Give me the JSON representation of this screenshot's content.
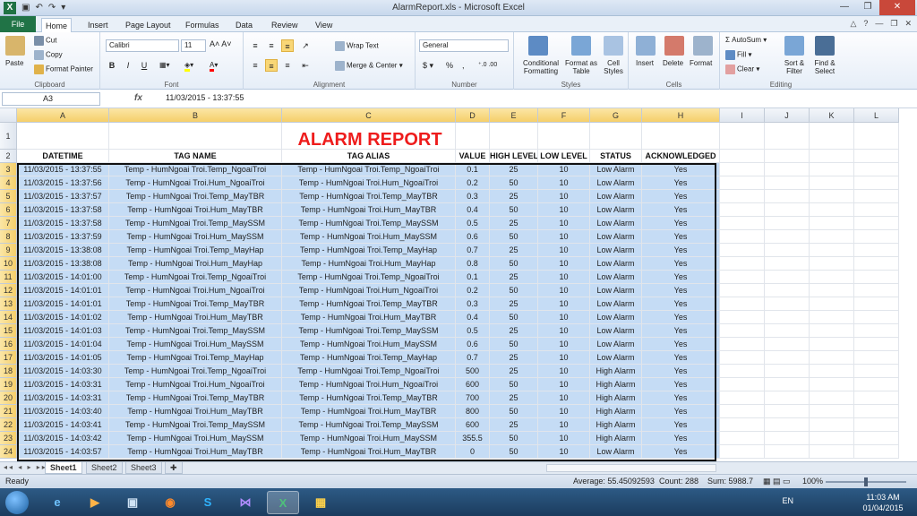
{
  "window": {
    "title": "AlarmReport.xls - Microsoft Excel",
    "app_logo": "X"
  },
  "ribbon_tabs": [
    "File",
    "Home",
    "Insert",
    "Page Layout",
    "Formulas",
    "Data",
    "Review",
    "View"
  ],
  "ribbon": {
    "clipboard": {
      "paste": "Paste",
      "cut": "Cut",
      "copy": "Copy",
      "format_painter": "Format Painter",
      "label": "Clipboard"
    },
    "font": {
      "name": "Calibri",
      "size": "11",
      "bold": "B",
      "italic": "I",
      "underline": "U",
      "label": "Font"
    },
    "alignment": {
      "wrap_text": "Wrap Text",
      "merge_center": "Merge & Center",
      "label": "Alignment"
    },
    "number": {
      "format": "General",
      "currency": "$",
      "percent": "%",
      "comma": ",",
      "label": "Number"
    },
    "styles": {
      "conditional": "Conditional Formatting",
      "format_table": "Format as Table",
      "cell_styles": "Cell Styles",
      "label": "Styles"
    },
    "cells": {
      "insert": "Insert",
      "delete": "Delete",
      "format": "Format",
      "label": "Cells"
    },
    "editing": {
      "autosum": "AutoSum",
      "fill": "Fill",
      "clear": "Clear",
      "sort_filter": "Sort & Filter",
      "find_select": "Find & Select",
      "label": "Editing"
    }
  },
  "formula_bar": {
    "name_box": "A3",
    "fx": "fx",
    "formula": "11/03/2015 - 13:37:55"
  },
  "columns": [
    "A",
    "B",
    "C",
    "D",
    "E",
    "F",
    "G",
    "H",
    "I",
    "J",
    "K",
    "L"
  ],
  "report_title": "ALARM REPORT",
  "headers": [
    "DATETIME",
    "TAG NAME",
    "TAG ALIAS",
    "VALUE",
    "HIGH LEVEL",
    "LOW LEVEL",
    "STATUS",
    "ACKNOWLEDGED"
  ],
  "rows": [
    [
      "11/03/2015 - 13:37:55",
      "Temp - HumNgoai Troi.Temp_NgoaiTroi",
      "Temp - HumNgoai Troi.Temp_NgoaiTroi",
      "0.1",
      "25",
      "10",
      "Low Alarm",
      "Yes"
    ],
    [
      "11/03/2015 - 13:37:56",
      "Temp - HumNgoai Troi.Hum_NgoaiTroi",
      "Temp - HumNgoai Troi.Hum_NgoaiTroi",
      "0.2",
      "50",
      "10",
      "Low Alarm",
      "Yes"
    ],
    [
      "11/03/2015 - 13:37:57",
      "Temp - HumNgoai Troi.Temp_MayTBR",
      "Temp - HumNgoai Troi.Temp_MayTBR",
      "0.3",
      "25",
      "10",
      "Low Alarm",
      "Yes"
    ],
    [
      "11/03/2015 - 13:37:58",
      "Temp - HumNgoai Troi.Hum_MayTBR",
      "Temp - HumNgoai Troi.Hum_MayTBR",
      "0.4",
      "50",
      "10",
      "Low Alarm",
      "Yes"
    ],
    [
      "11/03/2015 - 13:37:58",
      "Temp - HumNgoai Troi.Temp_MaySSM",
      "Temp - HumNgoai Troi.Temp_MaySSM",
      "0.5",
      "25",
      "10",
      "Low Alarm",
      "Yes"
    ],
    [
      "11/03/2015 - 13:37:59",
      "Temp - HumNgoai Troi.Hum_MaySSM",
      "Temp - HumNgoai Troi.Hum_MaySSM",
      "0.6",
      "50",
      "10",
      "Low Alarm",
      "Yes"
    ],
    [
      "11/03/2015 - 13:38:08",
      "Temp - HumNgoai Troi.Temp_MayHap",
      "Temp - HumNgoai Troi.Temp_MayHap",
      "0.7",
      "25",
      "10",
      "Low Alarm",
      "Yes"
    ],
    [
      "11/03/2015 - 13:38:08",
      "Temp - HumNgoai Troi.Hum_MayHap",
      "Temp - HumNgoai Troi.Hum_MayHap",
      "0.8",
      "50",
      "10",
      "Low Alarm",
      "Yes"
    ],
    [
      "11/03/2015 - 14:01:00",
      "Temp - HumNgoai Troi.Temp_NgoaiTroi",
      "Temp - HumNgoai Troi.Temp_NgoaiTroi",
      "0.1",
      "25",
      "10",
      "Low Alarm",
      "Yes"
    ],
    [
      "11/03/2015 - 14:01:01",
      "Temp - HumNgoai Troi.Hum_NgoaiTroi",
      "Temp - HumNgoai Troi.Hum_NgoaiTroi",
      "0.2",
      "50",
      "10",
      "Low Alarm",
      "Yes"
    ],
    [
      "11/03/2015 - 14:01:01",
      "Temp - HumNgoai Troi.Temp_MayTBR",
      "Temp - HumNgoai Troi.Temp_MayTBR",
      "0.3",
      "25",
      "10",
      "Low Alarm",
      "Yes"
    ],
    [
      "11/03/2015 - 14:01:02",
      "Temp - HumNgoai Troi.Hum_MayTBR",
      "Temp - HumNgoai Troi.Hum_MayTBR",
      "0.4",
      "50",
      "10",
      "Low Alarm",
      "Yes"
    ],
    [
      "11/03/2015 - 14:01:03",
      "Temp - HumNgoai Troi.Temp_MaySSM",
      "Temp - HumNgoai Troi.Temp_MaySSM",
      "0.5",
      "25",
      "10",
      "Low Alarm",
      "Yes"
    ],
    [
      "11/03/2015 - 14:01:04",
      "Temp - HumNgoai Troi.Hum_MaySSM",
      "Temp - HumNgoai Troi.Hum_MaySSM",
      "0.6",
      "50",
      "10",
      "Low Alarm",
      "Yes"
    ],
    [
      "11/03/2015 - 14:01:05",
      "Temp - HumNgoai Troi.Temp_MayHap",
      "Temp - HumNgoai Troi.Temp_MayHap",
      "0.7",
      "25",
      "10",
      "Low Alarm",
      "Yes"
    ],
    [
      "11/03/2015 - 14:03:30",
      "Temp - HumNgoai Troi.Temp_NgoaiTroi",
      "Temp - HumNgoai Troi.Temp_NgoaiTroi",
      "500",
      "25",
      "10",
      "High Alarm",
      "Yes"
    ],
    [
      "11/03/2015 - 14:03:31",
      "Temp - HumNgoai Troi.Hum_NgoaiTroi",
      "Temp - HumNgoai Troi.Hum_NgoaiTroi",
      "600",
      "50",
      "10",
      "High Alarm",
      "Yes"
    ],
    [
      "11/03/2015 - 14:03:31",
      "Temp - HumNgoai Troi.Temp_MayTBR",
      "Temp - HumNgoai Troi.Temp_MayTBR",
      "700",
      "25",
      "10",
      "High Alarm",
      "Yes"
    ],
    [
      "11/03/2015 - 14:03:40",
      "Temp - HumNgoai Troi.Hum_MayTBR",
      "Temp - HumNgoai Troi.Hum_MayTBR",
      "800",
      "50",
      "10",
      "High Alarm",
      "Yes"
    ],
    [
      "11/03/2015 - 14:03:41",
      "Temp - HumNgoai Troi.Temp_MaySSM",
      "Temp - HumNgoai Troi.Temp_MaySSM",
      "600",
      "25",
      "10",
      "High Alarm",
      "Yes"
    ],
    [
      "11/03/2015 - 14:03:42",
      "Temp - HumNgoai Troi.Hum_MaySSM",
      "Temp - HumNgoai Troi.Hum_MaySSM",
      "355.5",
      "50",
      "10",
      "High Alarm",
      "Yes"
    ],
    [
      "11/03/2015 - 14:03:57",
      "Temp - HumNgoai Troi.Hum_MayTBR",
      "Temp - HumNgoai Troi.Hum_MayTBR",
      "0",
      "50",
      "10",
      "Low Alarm",
      "Yes"
    ]
  ],
  "sheets": [
    "Sheet1",
    "Sheet2",
    "Sheet3"
  ],
  "status": {
    "ready": "Ready",
    "average": "Average: 55.45092593",
    "count": "Count: 288",
    "sum": "Sum: 5988.7",
    "zoom": "100%",
    "zoom_fraction": 0.5
  },
  "taskbar": {
    "lang": "EN",
    "time": "11:03 AM",
    "date": "01/04/2015"
  },
  "colors": {
    "accent": "#207346",
    "selection": "#c5dcf5",
    "title_red": "#ee1c1c"
  },
  "icons": [
    "excel-icon",
    "save-icon",
    "undo-icon",
    "redo-icon",
    "minimize-icon",
    "restore-icon",
    "close-icon",
    "help-icon",
    "paste-icon",
    "cut-icon",
    "copy-icon",
    "format-painter-icon",
    "fx-icon",
    "windows-start-icon",
    "ie-icon",
    "media-player-icon",
    "network-icon",
    "firefox-icon",
    "skype-icon",
    "vscode-icon",
    "excel-taskbar-icon",
    "paint-icon"
  ]
}
